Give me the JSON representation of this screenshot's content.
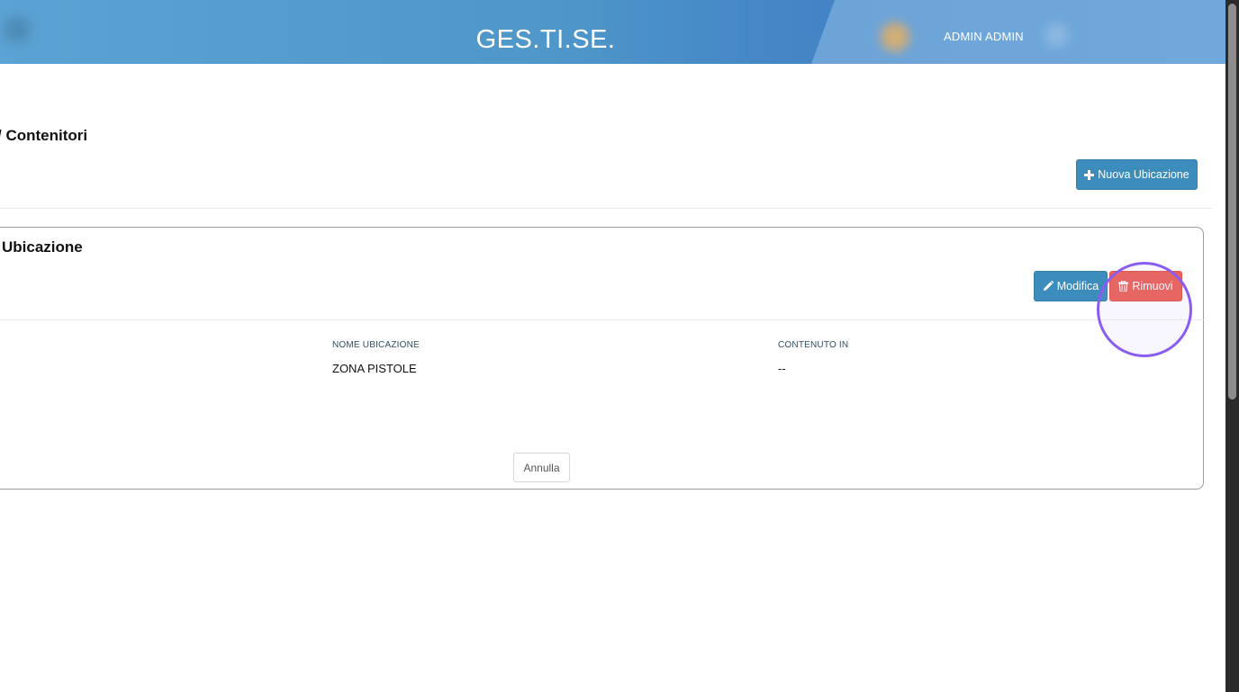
{
  "header": {
    "app_title": "GES.TI.SE.",
    "user_name": "ADMIN ADMIN"
  },
  "section": {
    "title": "/ Contenitori",
    "new_button_label": "Nuova Ubicazione"
  },
  "card": {
    "title": "Ubicazione",
    "edit_button_label": "Modifica",
    "remove_button_label": "Rimuovi",
    "fields": {
      "name_label": "NOME UBICAZIONE",
      "name_value": "ZONA PISTOLE",
      "content_label": "CONTENUTO IN",
      "content_value": "--"
    },
    "cancel_button_label": "Annulla"
  },
  "colors": {
    "primary": "#3c8dbc",
    "danger": "#ec6356",
    "highlight": "#8a5cf0"
  },
  "icons": {
    "new": "plus-icon",
    "edit": "pencil-icon",
    "remove": "trash-icon"
  }
}
